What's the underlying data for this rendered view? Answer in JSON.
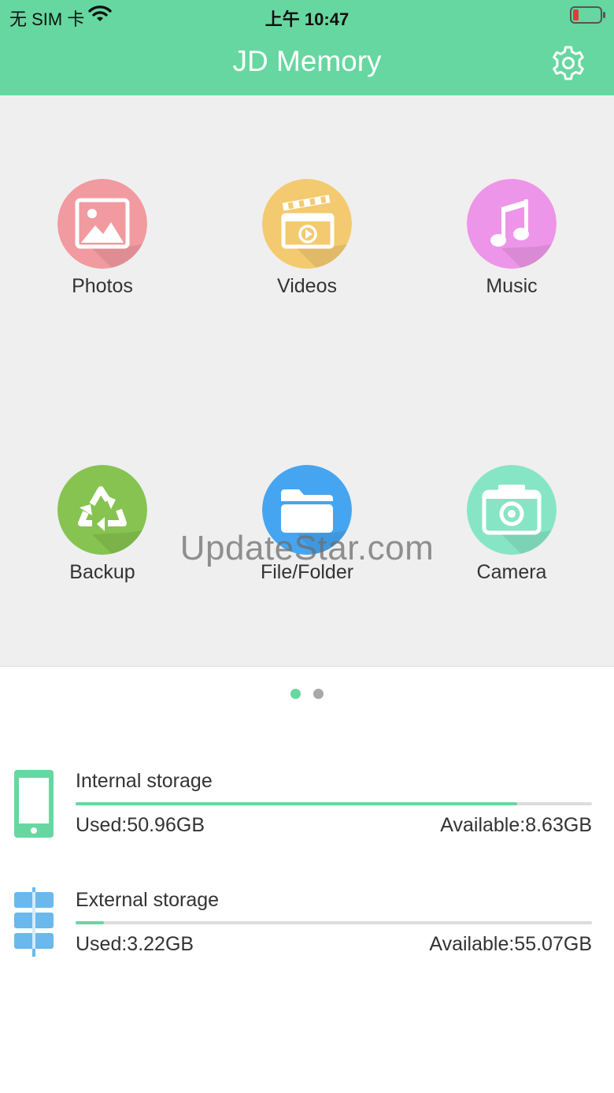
{
  "status_bar": {
    "carrier": "无 SIM 卡",
    "time": "上午 10:47",
    "battery_icon": "battery-low-icon",
    "wifi_icon": "wifi-icon"
  },
  "header": {
    "title": "JD Memory",
    "settings_icon": "gear-icon",
    "background_color": "#66d7a0"
  },
  "grid": {
    "tiles": [
      {
        "label": "Photos",
        "icon": "photo-icon",
        "color": "#f19a9f"
      },
      {
        "label": "Videos",
        "icon": "clapperboard-icon",
        "color": "#f3ca6f"
      },
      {
        "label": "Music",
        "icon": "music-note-icon",
        "color": "#ed95e8"
      },
      {
        "label": "Backup",
        "icon": "recycle-icon",
        "color": "#86c350"
      },
      {
        "label": "File/Folder",
        "icon": "folder-icon",
        "color": "#45a5f1"
      },
      {
        "label": "Camera",
        "icon": "camera-icon",
        "color": "#86e5c5"
      }
    ]
  },
  "watermark": "UpdateStar.com",
  "pager": {
    "total": 2,
    "active": 1
  },
  "storage": {
    "internal": {
      "title": "Internal storage",
      "used": "Used:50.96GB",
      "available": "Available:8.63GB",
      "used_fraction": 0.855,
      "icon": "phone-icon",
      "icon_color": "#66d7a0"
    },
    "external": {
      "title": "External storage",
      "used": "Used:3.22GB",
      "available": "Available:55.07GB",
      "used_fraction": 0.055,
      "icon": "server-icon",
      "icon_color": "#6bb8ec"
    }
  }
}
